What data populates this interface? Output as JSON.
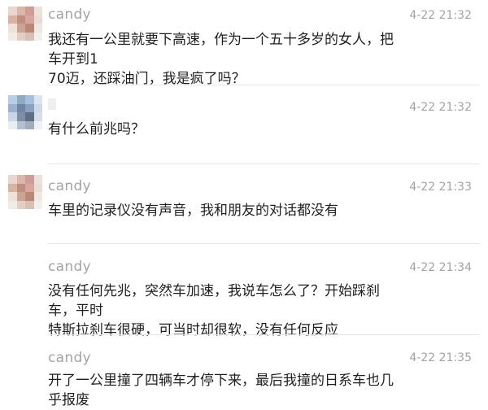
{
  "messages": [
    {
      "user": "candy",
      "time": "4-22 21:32",
      "text": "我还有一公里就要下高速，作为一个五十多岁的女人，把车开到1\n70迈，还踩油门，我是疯了吗？"
    },
    {
      "user": "",
      "time": "4-22 21:32",
      "text": "有什么前兆吗？"
    },
    {
      "user": "candy",
      "time": "4-22 21:33",
      "text": "车里的记录仪没有声音，我和朋友的对话都没有"
    },
    {
      "user": "candy",
      "time": "4-22 21:34",
      "text": "没有任何先兆，突然车加速，我说车怎么了？开始踩刹车，平时\n特斯拉刹车很硬，可当时却很软，没有任何反应"
    },
    {
      "user": "candy",
      "time": "4-22 21:35",
      "text": "开了一公里撞了四辆车才停下来，最后我撞的日系车也几乎报废"
    }
  ],
  "avatars": {
    "candy": "blurred-avatar",
    "other": "blurred-avatar"
  }
}
